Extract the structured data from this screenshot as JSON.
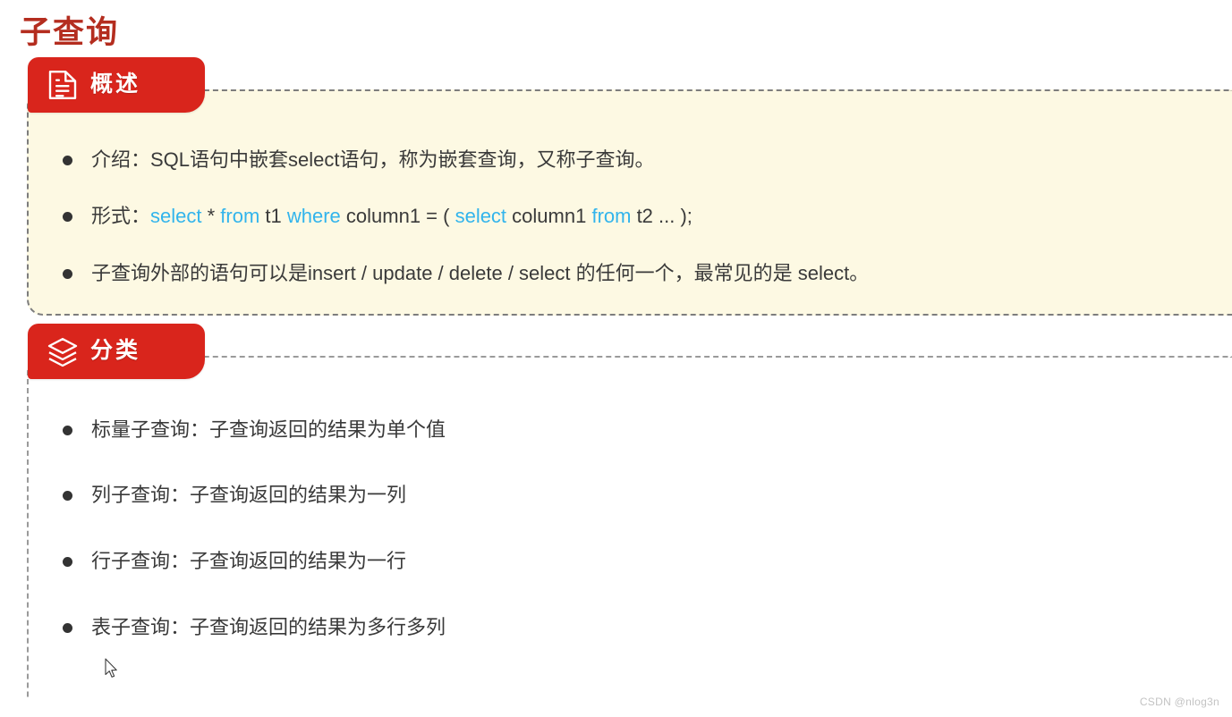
{
  "page": {
    "title": "子查询",
    "title_color": "#b42d1f",
    "accent_color": "#d9251c",
    "keyword_color": "#32b4ec",
    "overview_bg": "#fdf9e3"
  },
  "sections": [
    {
      "id": "overview",
      "badge_label": "概述",
      "badge_icon": "document-icon",
      "bullets": [
        {
          "id": "intro",
          "plain": "介绍：SQL语句中嵌套select语句，称为嵌套查询，又称子查询。",
          "parts": [
            {
              "text": "介绍：SQL语句中嵌套select语句，称为嵌套查询，又称子查询。",
              "kind": "text"
            }
          ]
        },
        {
          "id": "form",
          "plain": "形式：select * from  t1  where column1 = ( select column1 from t2 ... );",
          "parts": [
            {
              "text": "形式：",
              "kind": "text"
            },
            {
              "text": "select",
              "kind": "keyword"
            },
            {
              "text": " * ",
              "kind": "text"
            },
            {
              "text": "from",
              "kind": "keyword"
            },
            {
              "text": "  t1  ",
              "kind": "text"
            },
            {
              "text": "where",
              "kind": "keyword"
            },
            {
              "text": " column1 = ( ",
              "kind": "text"
            },
            {
              "text": "select",
              "kind": "keyword"
            },
            {
              "text": " column1 ",
              "kind": "text"
            },
            {
              "text": "from",
              "kind": "keyword"
            },
            {
              "text": " t2 ... );",
              "kind": "text"
            }
          ]
        },
        {
          "id": "outer-statement",
          "plain": "子查询外部的语句可以是insert / update / delete / select 的任何一个，最常见的是 select。",
          "parts": [
            {
              "text": "子查询外部的语句可以是insert / update / delete / select 的任何一个，最常见的是 select。",
              "kind": "text"
            }
          ]
        }
      ]
    },
    {
      "id": "category",
      "badge_label": "分类",
      "badge_icon": "layers-icon",
      "bullets": [
        {
          "id": "scalar",
          "plain": "标量子查询：子查询返回的结果为单个值",
          "parts": [
            {
              "text": "标量子查询：子查询返回的结果为单个值",
              "kind": "text"
            }
          ]
        },
        {
          "id": "column",
          "plain": "列子查询：子查询返回的结果为一列",
          "parts": [
            {
              "text": "列子查询：子查询返回的结果为一列",
              "kind": "text"
            }
          ]
        },
        {
          "id": "row",
          "plain": "行子查询：子查询返回的结果为一行",
          "parts": [
            {
              "text": "行子查询：子查询返回的结果为一行",
              "kind": "text"
            }
          ]
        },
        {
          "id": "table",
          "plain": "表子查询：子查询返回的结果为多行多列",
          "parts": [
            {
              "text": "表子查询：子查询返回的结果为多行多列",
              "kind": "text"
            }
          ]
        }
      ]
    }
  ],
  "watermark": "CSDN @nlog3n"
}
